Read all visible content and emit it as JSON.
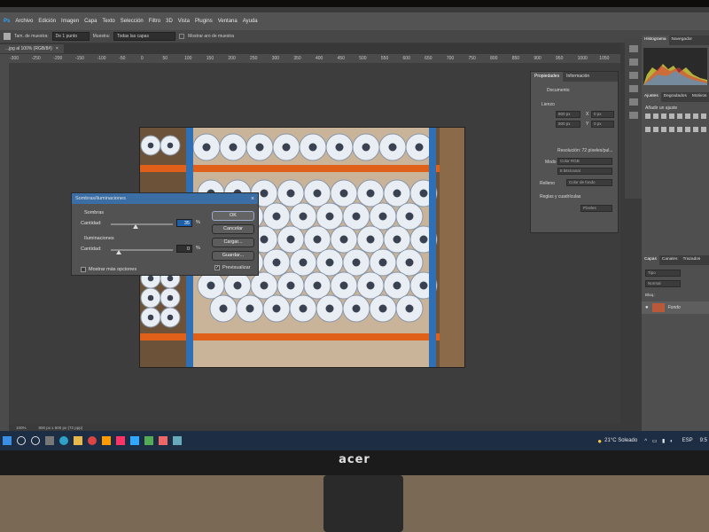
{
  "menu": [
    "Ps",
    "Archivo",
    "Edición",
    "Imagen",
    "Capa",
    "Texto",
    "Selección",
    "Filtro",
    "3D",
    "Vista",
    "Plugins",
    "Ventana",
    "Ayuda"
  ],
  "options": {
    "sample_size_label": "Tam. de muestra:",
    "sample_size_value": "De 1 punto",
    "sample_label": "Muestra:",
    "sample_value": "Todas las capas",
    "show_ring_label": "Mostrar aro de muestra"
  },
  "doc_tab": {
    "label": "...jpg al 100% (RGB/8#)",
    "close": "×"
  },
  "ruler_ticks": [
    "-300",
    "-250",
    "-200",
    "-150",
    "-100",
    "-50",
    "0",
    "50",
    "100",
    "150",
    "200",
    "250",
    "300",
    "350",
    "400",
    "450",
    "500",
    "550",
    "600",
    "650",
    "700",
    "750",
    "800",
    "850",
    "900",
    "950",
    "1000",
    "1050"
  ],
  "dialog": {
    "title": "Sombras/iluminaciones",
    "close": "×",
    "shadows_group": "Sombras",
    "shadows_amount_label": "Cantidad:",
    "shadows_amount_value": "35",
    "highlights_group": "Iluminaciones",
    "highlights_amount_label": "Cantidad:",
    "highlights_amount_value": "0",
    "percent": "%",
    "show_more_label": "Mostrar más opciones",
    "preview_label": "Previsualizar",
    "buttons": {
      "ok": "OK",
      "cancel": "Cancelar",
      "load": "Cargar...",
      "save": "Guardar..."
    }
  },
  "properties": {
    "tabs": [
      "Propiedades",
      "Información"
    ],
    "document_label": "Documento",
    "canvas_label": "Lienzo",
    "w_value": "800 px",
    "h_value": "600 px",
    "x_label": "X",
    "y_label": "Y",
    "x_value": "0 px",
    "y_value": "0 px",
    "resolution": "Resolución: 72 píxeles/pul...",
    "mode_label": "Modo",
    "mode_value": "Color RGB",
    "bits_value": "8 bits/canal",
    "fill_label": "Relleno",
    "fill_value": "Color de fondo",
    "guides_label": "Reglas y cuadrículas",
    "units_value": "Píxeles"
  },
  "right_panel": {
    "top_tabs": [
      "Histograma",
      "Navegador"
    ],
    "adj_tabs": [
      "Ajustes",
      "Degradados",
      "Motivos"
    ],
    "add_adjustment": "Añadir un ajuste",
    "layer_tabs": [
      "Capas",
      "Canales",
      "Trazados"
    ],
    "search_placeholder": "Tipo",
    "blend_mode": "Normal",
    "lock_label": "Bloq.:",
    "layer_name": "Fondo"
  },
  "statusbar": {
    "zoom": "100%",
    "size": "800 px x 600 px (72 ppp)"
  },
  "taskbar": {
    "weather": "21°C Soleado",
    "lang": "ESP",
    "time": "9:5"
  },
  "brand": "acer",
  "colors": {
    "accent": "#3a6ea5",
    "shelf_orange": "#e0601a",
    "upright_blue": "#2f6fb5"
  }
}
